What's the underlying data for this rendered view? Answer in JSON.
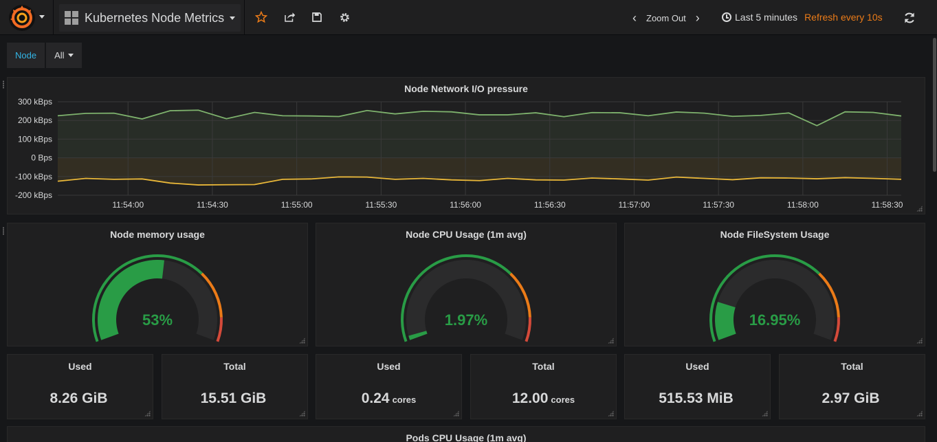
{
  "navbar": {
    "dashboard_title": "Kubernetes Node Metrics",
    "zoom_out": "Zoom Out",
    "time_range": "Last 5 minutes",
    "refresh": "Refresh every 10s"
  },
  "variables": {
    "node_label": "Node",
    "node_value": "All"
  },
  "network_panel": {
    "title": "Node Network I/O pressure",
    "y_ticks": [
      "300 kBps",
      "200 kBps",
      "100 kBps",
      "0 Bps",
      "-100 kBps",
      "-200 kBps"
    ],
    "x_ticks": [
      "11:54:00",
      "11:54:30",
      "11:55:00",
      "11:55:30",
      "11:56:00",
      "11:56:30",
      "11:57:00",
      "11:57:30",
      "11:58:00",
      "11:58:30"
    ]
  },
  "chart_data": {
    "type": "area",
    "title": "Node Network I/O pressure",
    "ylim": [
      -200,
      300
    ],
    "y_unit": "kBps",
    "grid": true,
    "x": [
      "11:53:35",
      "11:53:45",
      "11:53:55",
      "11:54:05",
      "11:54:15",
      "11:54:25",
      "11:54:35",
      "11:54:45",
      "11:54:55",
      "11:55:05",
      "11:55:15",
      "11:55:25",
      "11:55:35",
      "11:55:45",
      "11:55:55",
      "11:56:05",
      "11:56:15",
      "11:56:25",
      "11:56:35",
      "11:56:45",
      "11:56:55",
      "11:57:05",
      "11:57:15",
      "11:57:25",
      "11:57:35",
      "11:57:45",
      "11:57:55",
      "11:58:05",
      "11:58:15",
      "11:58:25",
      "11:58:35",
      "11:58:45"
    ],
    "series": [
      {
        "color": "#7eb26d",
        "values": [
          225,
          238,
          239,
          208,
          252,
          255,
          209,
          243,
          225,
          224,
          221,
          253,
          235,
          249,
          246,
          230,
          230,
          241,
          220,
          242,
          241,
          225,
          245,
          239,
          222,
          227,
          240,
          172,
          246,
          243,
          224
        ]
      },
      {
        "color": "#eab839",
        "values": [
          -125,
          -110,
          -115,
          -113,
          -135,
          -145,
          -144,
          -143,
          -115,
          -113,
          -102,
          -103,
          -115,
          -110,
          -118,
          -122,
          -110,
          -118,
          -119,
          -108,
          -113,
          -119,
          -103,
          -110,
          -117,
          -107,
          -108,
          -112,
          -106,
          -110,
          -115
        ]
      }
    ]
  },
  "gauges": [
    {
      "title": "Node memory usage",
      "value_text": "53%",
      "fraction": 0.53
    },
    {
      "title": "Node CPU Usage (1m avg)",
      "value_text": "1.97%",
      "fraction": 0.0197
    },
    {
      "title": "Node FileSystem Usage",
      "value_text": "16.95%",
      "fraction": 0.1695
    }
  ],
  "stats": [
    {
      "title": "Used",
      "value": "8.26 GiB",
      "unit": ""
    },
    {
      "title": "Total",
      "value": "15.51 GiB",
      "unit": ""
    },
    {
      "title": "Used",
      "value": "0.24",
      "unit": "cores"
    },
    {
      "title": "Total",
      "value": "12.00",
      "unit": "cores"
    },
    {
      "title": "Used",
      "value": "515.53 MiB",
      "unit": ""
    },
    {
      "title": "Total",
      "value": "2.97 GiB",
      "unit": ""
    }
  ],
  "bottom_panel": {
    "title": "Pods CPU Usage (1m avg)"
  },
  "colors": {
    "ok": "#299c46",
    "warn": "#eb7b18",
    "crit": "#d44a3a",
    "accent": "#33b5e5"
  }
}
